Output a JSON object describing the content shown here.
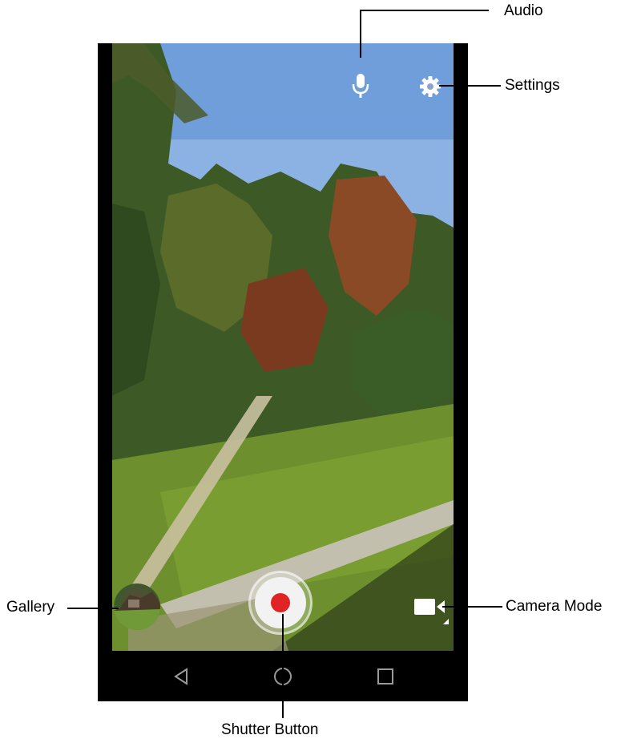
{
  "callouts": {
    "audio": "Audio",
    "settings": "Settings",
    "gallery": "Gallery",
    "camera_mode": "Camera Mode",
    "shutter_button": "Shutter Button"
  },
  "icons": {
    "audio": "microphone-icon",
    "settings": "gear-icon",
    "gallery": "gallery-thumbnail",
    "camera_mode": "video-camera-icon",
    "shutter": "record-button",
    "nav_back": "back-triangle-icon",
    "nav_home": "home-circle-icon",
    "nav_recents": "recents-square-icon"
  },
  "colors": {
    "record_dot": "#e02426",
    "shutter_ring": "#f2f2f2",
    "nav_icon": "#9a9a9a"
  }
}
